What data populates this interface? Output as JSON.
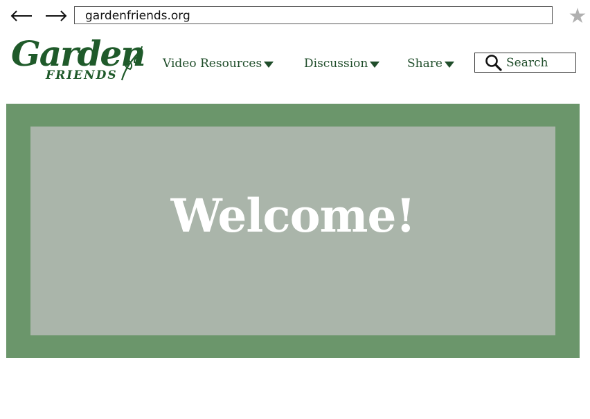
{
  "browser": {
    "url": "gardenfriends.org",
    "back_icon": "back-arrow-icon",
    "forward_icon": "forward-arrow-icon",
    "bookmark_icon": "star-icon",
    "bookmark_color": "#b0b0b0"
  },
  "logo": {
    "word1": "Garden",
    "word2": "FRIENDS",
    "icon": "leaf-icon",
    "color": "#1f5a2a"
  },
  "nav": {
    "items": [
      {
        "label": "Video Resources",
        "has_dropdown": true
      },
      {
        "label": "Discussion",
        "has_dropdown": true
      },
      {
        "label": "Share",
        "has_dropdown": true
      }
    ]
  },
  "search": {
    "label": "Search",
    "icon": "search-icon"
  },
  "hero": {
    "title": "Welcome!",
    "outer_color": "#6b966b",
    "inner_color": "#aab5aa"
  }
}
